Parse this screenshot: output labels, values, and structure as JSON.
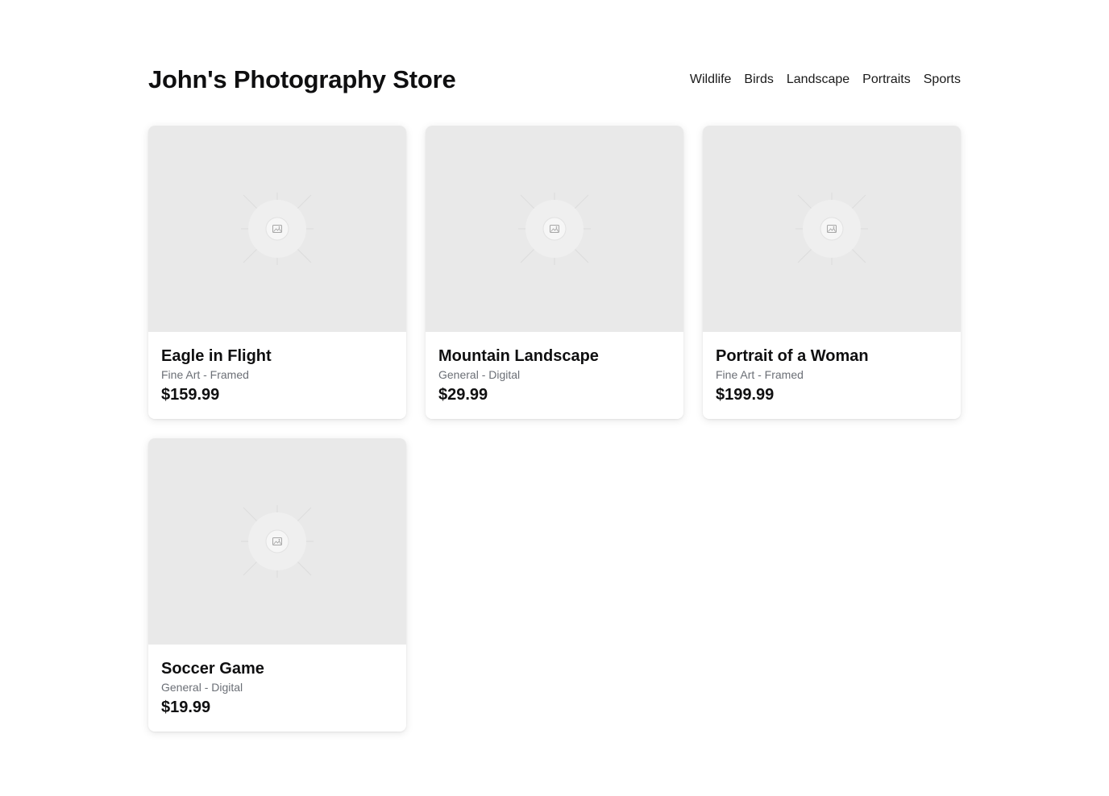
{
  "header": {
    "store_title": "John's Photography Store"
  },
  "nav": {
    "items": [
      {
        "label": "Wildlife"
      },
      {
        "label": "Birds"
      },
      {
        "label": "Landscape"
      },
      {
        "label": "Portraits"
      },
      {
        "label": "Sports"
      }
    ]
  },
  "products": [
    {
      "title": "Eagle in Flight",
      "meta": "Fine Art - Framed",
      "price": "$159.99",
      "image_icon": "image-placeholder-icon"
    },
    {
      "title": "Mountain Landscape",
      "meta": "General - Digital",
      "price": "$29.99",
      "image_icon": "image-placeholder-icon"
    },
    {
      "title": "Portrait of a Woman",
      "meta": "Fine Art - Framed",
      "price": "$199.99",
      "image_icon": "image-placeholder-icon"
    },
    {
      "title": "Soccer Game",
      "meta": "General - Digital",
      "price": "$19.99",
      "image_icon": "image-placeholder-icon"
    }
  ],
  "colors": {
    "background": "#ffffff",
    "placeholder": "#e9e9e9",
    "text": "#0f0f10",
    "muted": "#6b6f76"
  }
}
